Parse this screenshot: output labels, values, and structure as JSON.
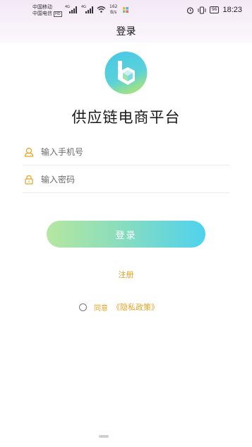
{
  "status_bar": {
    "carrier1": "中国移动",
    "carrier2": "中国电信",
    "hd": "HD",
    "sig1": "4G",
    "sig2": "4G",
    "speed_value": "162",
    "speed_unit": "B/s",
    "battery": "96",
    "time": "18:23",
    "icons": [
      "signal-icon",
      "wifi-icon",
      "alarm-icon",
      "vibrate-icon",
      "battery-icon"
    ]
  },
  "header": {
    "title": "登录"
  },
  "app": {
    "name": "供应链电商平台",
    "logo_icon": "b-cube-logo"
  },
  "form": {
    "phone_placeholder": "输入手机号",
    "password_placeholder": "输入密码"
  },
  "actions": {
    "login_label": "登录",
    "register_label": "注册"
  },
  "agreement": {
    "agree_text": "同意",
    "policy_link": "《隐私政策》"
  },
  "colors": {
    "accent": "#e5a322",
    "button_start": "#b5e7a0",
    "button_end": "#4fd2ee",
    "logo_primary": "#47c7e8"
  }
}
